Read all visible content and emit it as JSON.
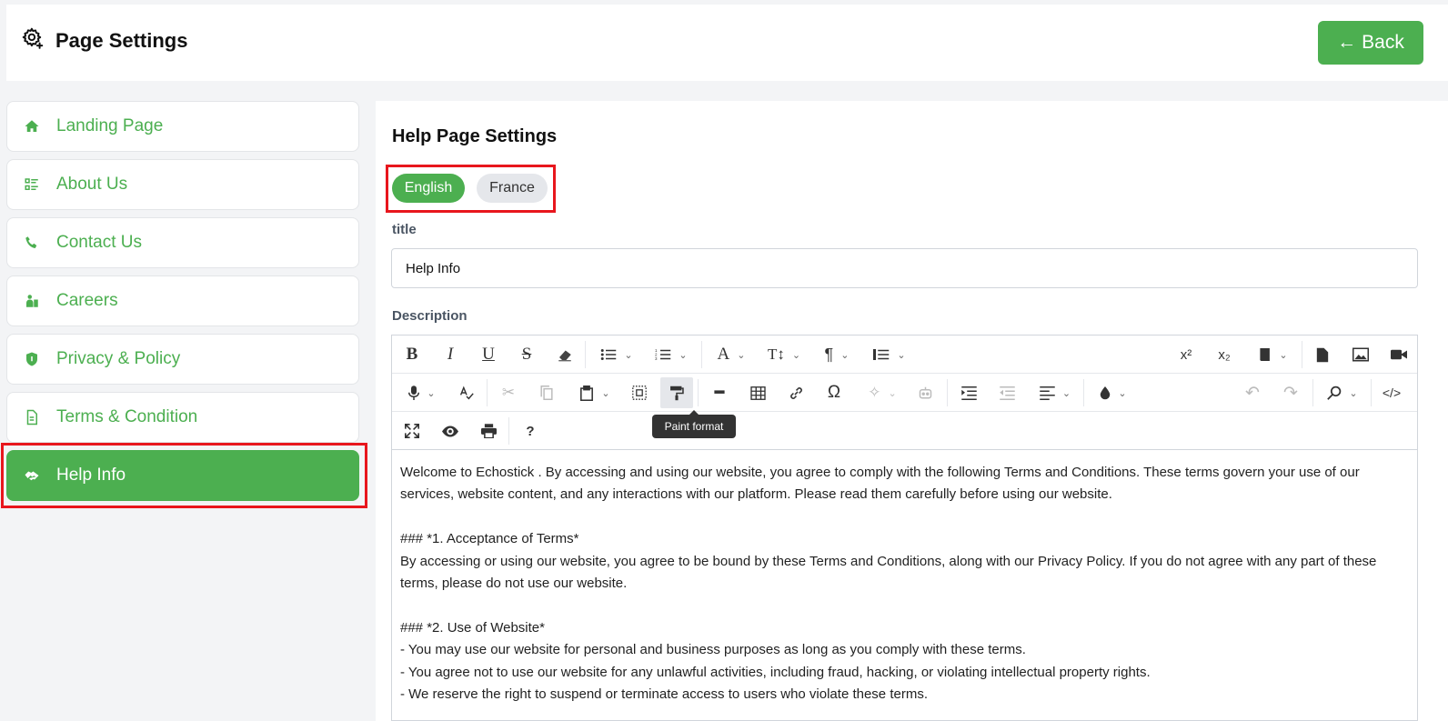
{
  "header": {
    "title": "Page Settings",
    "back_label": "Back"
  },
  "sidebar": {
    "items": [
      {
        "label": "Landing Page",
        "icon": "home-icon"
      },
      {
        "label": "About Us",
        "icon": "list-icon"
      },
      {
        "label": "Contact Us",
        "icon": "phone-icon"
      },
      {
        "label": "Careers",
        "icon": "career-icon"
      },
      {
        "label": "Privacy & Policy",
        "icon": "shield-icon"
      },
      {
        "label": "Terms & Condition",
        "icon": "document-icon"
      },
      {
        "label": "Help Info",
        "icon": "handshake-icon",
        "active": true
      }
    ]
  },
  "main": {
    "heading": "Help Page Settings",
    "languages": [
      "English",
      "France"
    ],
    "active_language": "English",
    "title_label": "title",
    "title_value": "Help Info",
    "description_label": "Description",
    "tooltip": "Paint format",
    "content": {
      "p1": "Welcome to Echostick . By accessing and using our website, you agree to comply with the following Terms and Conditions. These terms govern your use of our services, website content, and any interactions with our platform. Please read them carefully before using our website.",
      "h1": "### *1. Acceptance of Terms*",
      "p2": "By accessing or using our website, you agree to be bound by these Terms and Conditions, along with our Privacy Policy. If you do not agree with any part of these terms, please do not use our website.",
      "h2": "### *2. Use of Website*",
      "b1": "- You may use our website for personal and business purposes as long as you comply with these terms.",
      "b2": "- You agree not to use our website for any unlawful activities, including fraud, hacking, or violating intellectual property rights.",
      "b3": "- We reserve the right to suspend or terminate access to users who violate these terms."
    }
  },
  "colors": {
    "accent": "#4caf50",
    "highlight": "#e8161d"
  }
}
